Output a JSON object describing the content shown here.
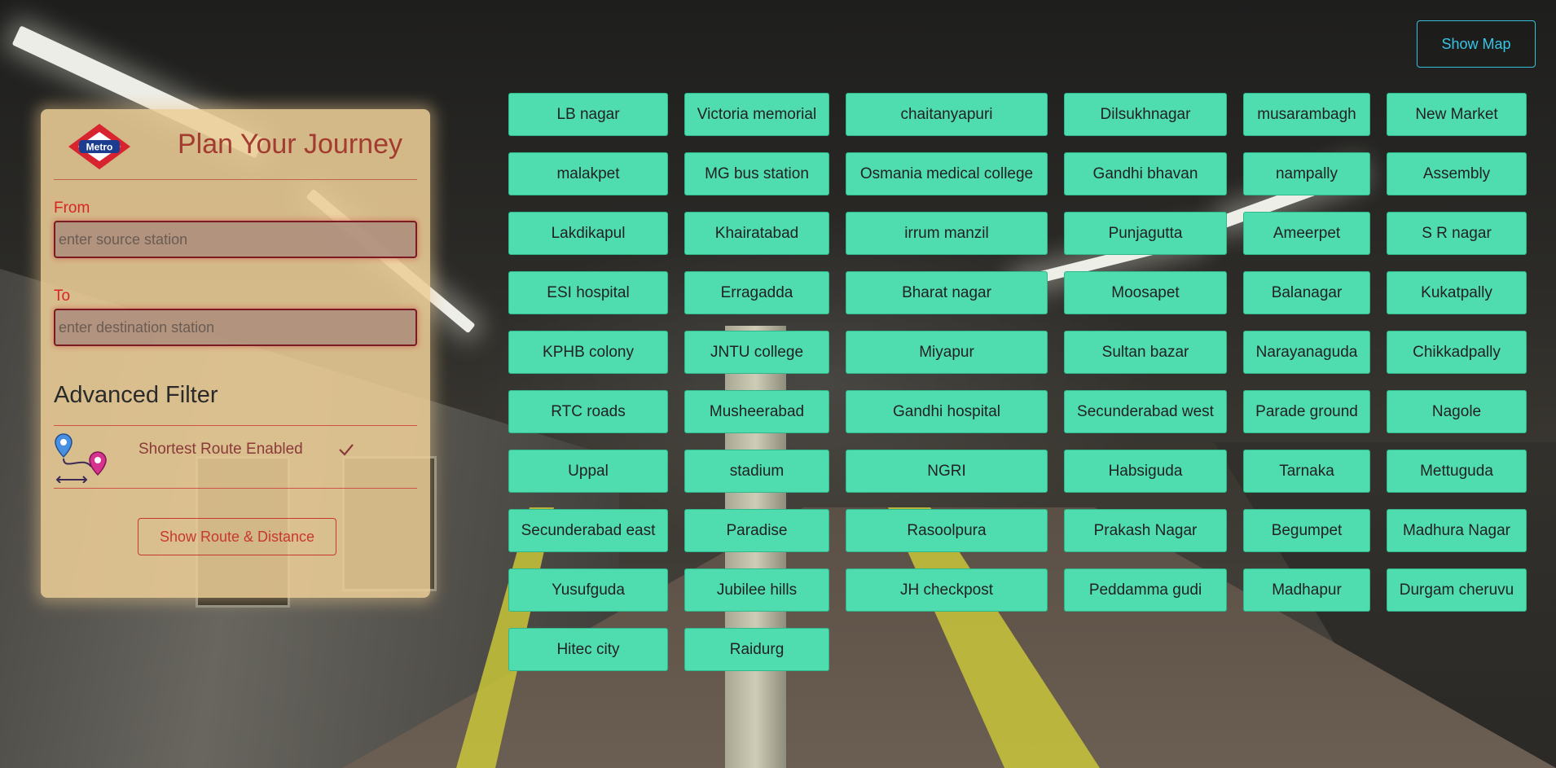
{
  "header": {
    "show_map_label": "Show Map"
  },
  "planner": {
    "logo_text": "Metro",
    "title": "Plan Your Journey",
    "from_label": "From",
    "from_placeholder": "enter source station",
    "from_value": "",
    "to_label": "To",
    "to_placeholder": "enter destination station",
    "to_value": "",
    "advanced_title": "Advanced Filter",
    "shortest_route_label": "Shortest Route Enabled",
    "shortest_route_enabled": true,
    "submit_label": "Show Route & Distance"
  },
  "stations": [
    "LB nagar",
    "Victoria memorial",
    "chaitanyapuri",
    "Dilsukhnagar",
    "musarambagh",
    "New Market",
    "malakpet",
    "MG bus station",
    "Osmania medical college",
    "Gandhi bhavan",
    "nampally",
    "Assembly",
    "Lakdikapul",
    "Khairatabad",
    "irrum manzil",
    "Punjagutta",
    "Ameerpet",
    "S R nagar",
    "ESI hospital",
    "Erragadda",
    "Bharat nagar",
    "Moosapet",
    "Balanagar",
    "Kukatpally",
    "KPHB colony",
    "JNTU college",
    "Miyapur",
    "Sultan bazar",
    "Narayanaguda",
    "Chikkadpally",
    "RTC roads",
    "Musheerabad",
    "Gandhi hospital",
    "Secunderabad west",
    "Parade ground",
    "Nagole",
    "Uppal",
    "stadium",
    "NGRI",
    "Habsiguda",
    "Tarnaka",
    "Mettuguda",
    "Secunderabad east",
    "Paradise",
    "Rasoolpura",
    "Prakash Nagar",
    "Begumpet",
    "Madhura Nagar",
    "Yusufguda",
    "Jubilee hills",
    "JH checkpost",
    "Peddamma gudi",
    "Madhapur",
    "Durgam cheruvu",
    "Hitec city",
    "Raidurg"
  ],
  "icons": {
    "logo": "metro-logo-icon",
    "route": "route-pins-icon",
    "check": "check-icon"
  },
  "colors": {
    "station_bg": "#4fdcae",
    "panel_bg": "#ecd096",
    "title": "#a33b30",
    "accent_red": "#c7382e",
    "map_button": "#37c5e6"
  }
}
